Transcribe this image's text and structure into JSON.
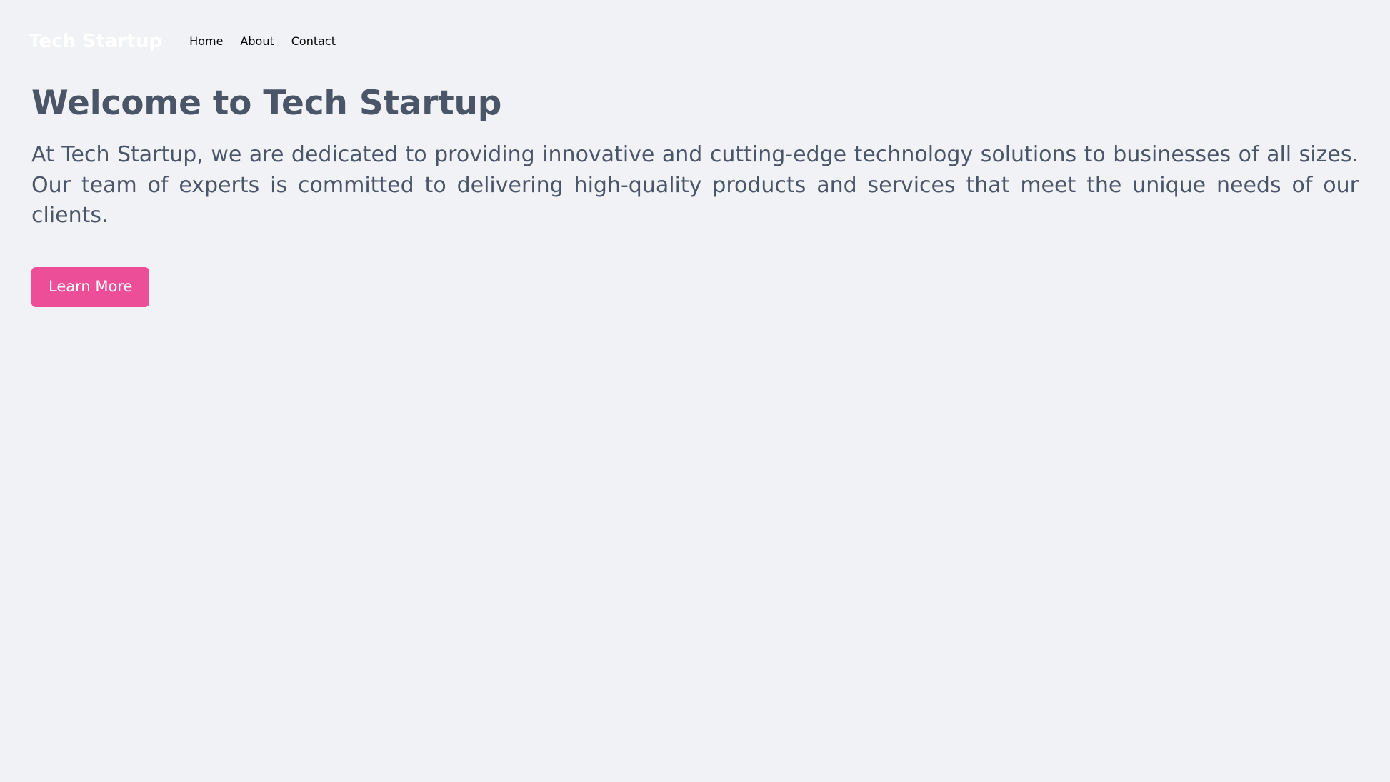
{
  "page": {
    "background_color": "#f1f2f6",
    "text_color": "#4a5568",
    "accent_color": "#ed4e98"
  },
  "navbar": {
    "brand": "Tech Startup",
    "brand_color": "#ffffff",
    "links": [
      {
        "label": "Home"
      },
      {
        "label": "About"
      },
      {
        "label": "Contact"
      }
    ]
  },
  "hero": {
    "title": "Welcome to Tech Startup",
    "paragraph": "At Tech Startup, we are dedicated to providing innovative and cutting-edge technology solutions to businesses of all sizes. Our team of experts is committed to delivering high-quality products and services that meet the unique needs of our clients.",
    "cta_label": "Learn More"
  }
}
